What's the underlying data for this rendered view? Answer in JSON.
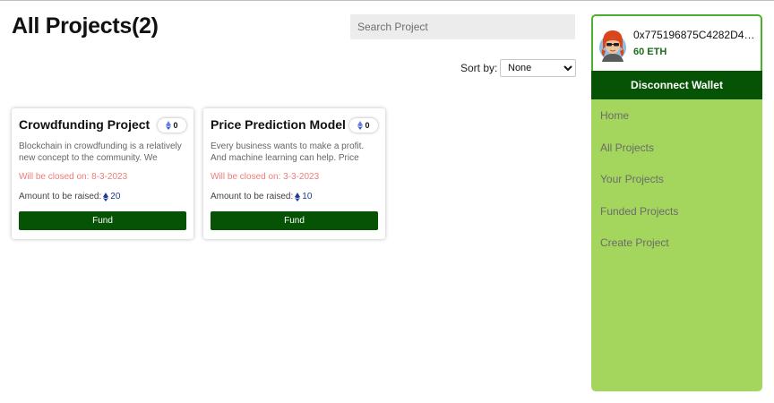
{
  "header": {
    "title": "All Projects(2)",
    "search_placeholder": "Search Project",
    "sort_label": "Sort by:",
    "sort_selected": "None"
  },
  "projects": [
    {
      "title": "Crowdfunding Project",
      "eth_count": "0",
      "description": "Blockchain in crowdfunding is a relatively new concept to the community. We have…",
      "closing": "Will be closed on: 8-3-2023",
      "amount_label": "Amount to be raised:",
      "amount": "20",
      "button": "Fund"
    },
    {
      "title": "Price Prediction Model",
      "eth_count": "0",
      "description": "Every business wants to make a profit. And machine learning can help. Price predictio…",
      "closing": "Will be closed on: 3-3-2023",
      "amount_label": "Amount to be raised:",
      "amount": "10",
      "button": "Fund"
    }
  ],
  "wallet": {
    "address": "0x775196875C4282D4dF…",
    "balance": "60 ETH",
    "disconnect_label": "Disconnect Wallet"
  },
  "nav": {
    "items": [
      "Home",
      "All Projects",
      "Your Projects",
      "Funded Projects",
      "Create Project"
    ]
  },
  "colors": {
    "primary_green": "#065306",
    "sidebar_green": "#a4d65e",
    "close_date_red": "#ef7c7c",
    "eth_blue": "#627eea"
  },
  "icons": {
    "eth": "ethereum-icon",
    "avatar": "user-avatar",
    "dropdown": "chevron-down-icon"
  }
}
